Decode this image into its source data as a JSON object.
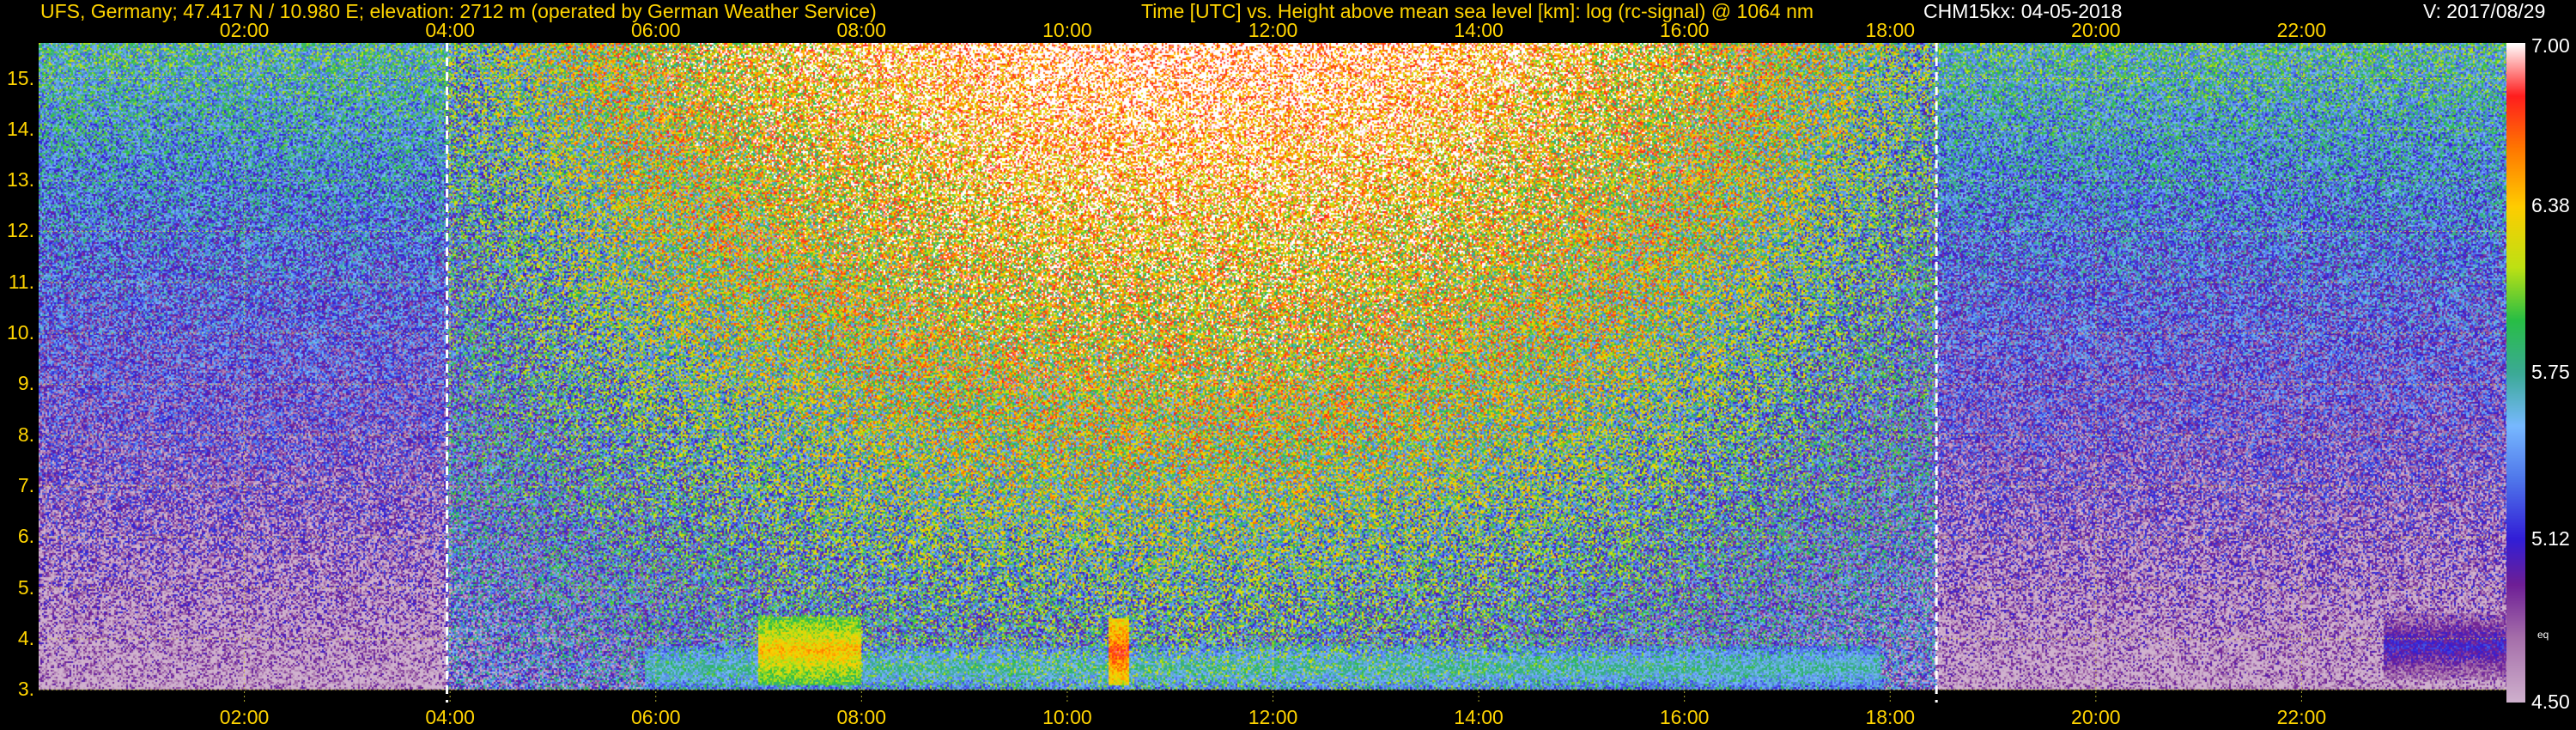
{
  "header": {
    "station": "UFS, Germany; 47.417 N / 10.980 E; elevation: 2712 m  (operated by German Weather Service)",
    "description": "Time [UTC] vs. Height above mean sea level [km]: log (rc-signal) @ 1064 nm",
    "instrument_date": "CHM15kx: 04-05-2018",
    "version": "V: 2017/08/29"
  },
  "colors": {
    "text": "#ffd400",
    "grid": "#d7d23a",
    "night_marker": "#ffffff",
    "colorbar_text": "#ffffff"
  },
  "chart_data": {
    "type": "heatmap",
    "title": "Time [UTC] vs. Height above mean sea level [km]: log (rc-signal) @ 1064 nm",
    "x_ticks": [
      "02:00",
      "04:00",
      "06:00",
      "08:00",
      "10:00",
      "12:00",
      "14:00",
      "16:00",
      "18:00",
      "20:00",
      "22:00"
    ],
    "x_tick_hours": [
      2,
      4,
      6,
      8,
      10,
      12,
      14,
      16,
      18,
      20,
      22
    ],
    "xlim_hours": [
      0.0,
      24.0
    ],
    "y_ticks": [
      "15.",
      "14.",
      "13.",
      "12.",
      "11.",
      "10.",
      "9.",
      "8.",
      "7.",
      "6.",
      "5.",
      "4.",
      "3."
    ],
    "y_tick_values": [
      15,
      14,
      13,
      12,
      11,
      10,
      9,
      8,
      7,
      6,
      5,
      4,
      3
    ],
    "ylim": [
      2.75,
      15.7
    ],
    "grid": true,
    "sunrise_sunset_hours": [
      3.97,
      18.45
    ],
    "colorbar": {
      "labels": [
        "7.00",
        "6.38",
        "5.75",
        "5.12",
        "4.50"
      ],
      "values": [
        7.0,
        6.38,
        5.75,
        5.12,
        4.5
      ],
      "unit": "eq",
      "colors": [
        "#ffffff",
        "#ff2020",
        "#ff7a00",
        "#ffd200",
        "#c8e000",
        "#30c040",
        "#40b0b0",
        "#80b0ff",
        "#2040e0",
        "#6000a0",
        "#a060a0",
        "#d0b0d0"
      ]
    },
    "features": [
      {
        "name": "aerosol layer",
        "from_hour": 5.9,
        "to_hour": 17.9,
        "base_km": 3.0,
        "top_km": 3.85,
        "level": 5.6
      },
      {
        "name": "convective plume",
        "from_hour": 7.0,
        "to_hour": 8.0,
        "base_km": 3.1,
        "top_km": 4.45,
        "level": 6.3
      },
      {
        "name": "convective plume",
        "from_hour": 10.4,
        "to_hour": 10.6,
        "base_km": 3.1,
        "top_km": 4.4,
        "level": 6.6
      },
      {
        "name": "evening residual layer",
        "from_hour": 22.8,
        "to_hour": 24.0,
        "base_km": 3.2,
        "top_km": 4.5,
        "level": 5.0
      }
    ]
  }
}
